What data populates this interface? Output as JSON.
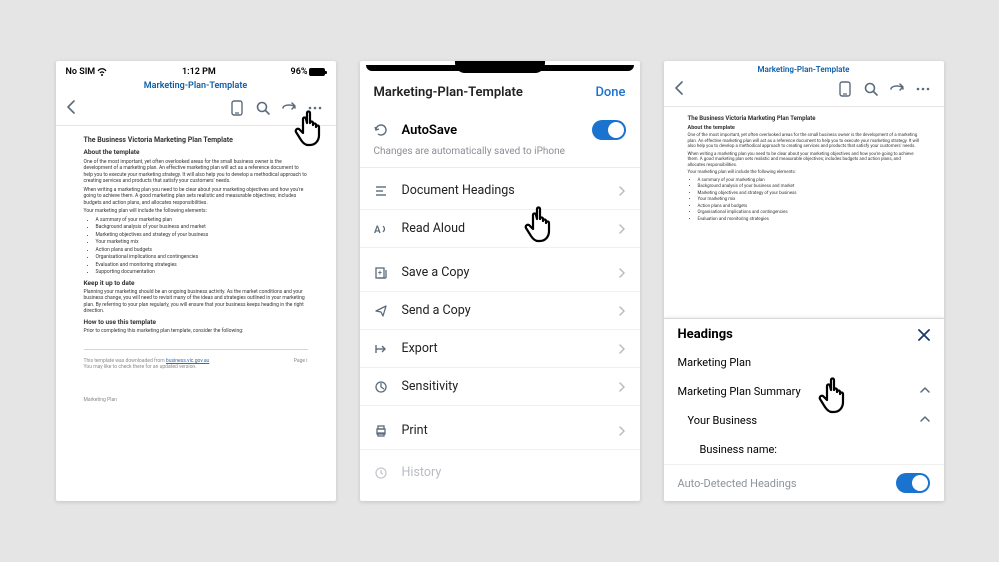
{
  "panel1": {
    "status": {
      "no_sim": "No SIM",
      "time": "1:12 PM",
      "battery": "96%"
    },
    "title": "Marketing-Plan-Template",
    "doc": {
      "h1": "The Business Victoria Marketing Plan Template",
      "about_h": "About the template",
      "about_p1": "One of the most important, yet often overlooked areas for the small business owner is the development of a marketing plan. An effective marketing plan will act as a reference document to help you to execute your marketing strategy. It will also help you to develop a methodical approach to creating services and products that satisfy your customers' needs.",
      "about_p2": "When writing a marketing plan you need to be clear about your marketing objectives and how you're going to achieve them. A good marketing plan sets realistic and measurable objectives; includes budgets and action plans, and allocates responsibilities.",
      "elements_intro": "Your marketing plan will include the following elements:",
      "elements": [
        "A summary of your marketing plan",
        "Background analysis of your business and market",
        "Marketing objectives and strategy of your business",
        "Your marketing mix",
        "Action plans and budgets",
        "Organisational implications and contingencies",
        "Evaluation and monitoring strategies",
        "Supporting documentation"
      ],
      "keep_h": "Keep it up to date",
      "keep_p": "Planning your marketing should be an ongoing business activity. As the market conditions and your business change, you will need to revisit many of the ideas and strategies outlined in your marketing plan. By referring to your plan regularly, you will ensure that your business keeps heading in the right direction.",
      "howto_h": "How to use this template",
      "howto_p": "Prior to completing this marketing plan template, consider the following:",
      "disclaimer_main": "This template was downloaded from ",
      "disclaimer_link": "business.vic.gov.au",
      "disclaimer_sub": "You may like to check there for an updated version.",
      "page_label": "Page i",
      "footer": "Marketing Plan"
    }
  },
  "panel2": {
    "title": "Marketing-Plan-Template",
    "done": "Done",
    "autosave_label": "AutoSave",
    "autosave_hint": "Changes are automatically saved to iPhone",
    "items": [
      {
        "label": "Document Headings"
      },
      {
        "label": "Read Aloud"
      },
      {
        "label": "Save a Copy"
      },
      {
        "label": "Send a Copy"
      },
      {
        "label": "Export"
      },
      {
        "label": "Sensitivity"
      },
      {
        "label": "Print"
      },
      {
        "label": "History"
      }
    ]
  },
  "panel3": {
    "title": "Marketing-Plan-Template",
    "headings_title": "Headings",
    "items": [
      {
        "label": "Marketing Plan"
      },
      {
        "label": "Marketing Plan Summary"
      },
      {
        "label": "Your Business"
      },
      {
        "label": "Business name:"
      }
    ],
    "autodetect": "Auto-Detected Headings"
  }
}
